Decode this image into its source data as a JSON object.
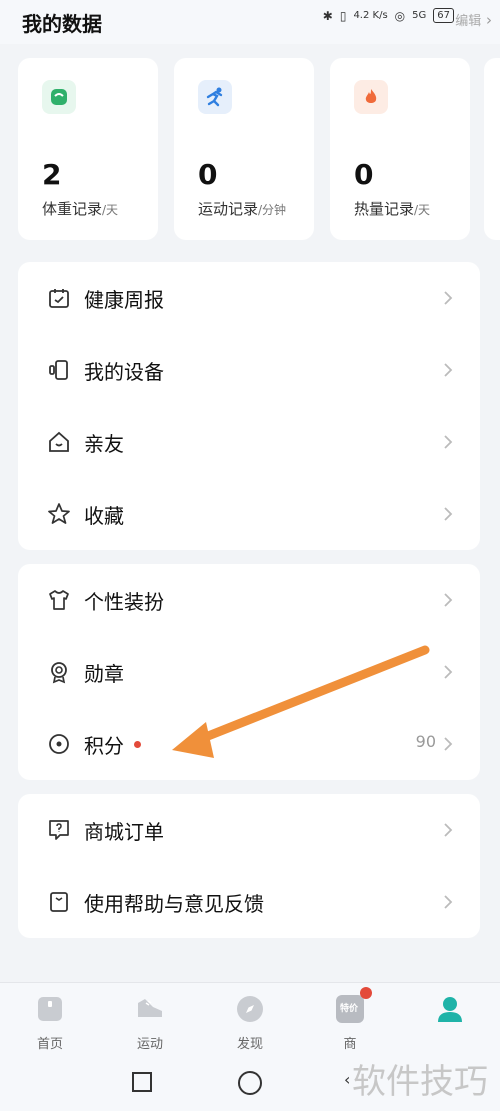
{
  "header": {
    "title": "我的数据",
    "status": {
      "network": "4.2 K/s",
      "signal": "5G",
      "battery": "67"
    },
    "edit_label": "编辑"
  },
  "stats": [
    {
      "icon": "scale-icon",
      "value": "2",
      "label": "体重记录",
      "unit": "/天",
      "color": "#2fb06b"
    },
    {
      "icon": "running-icon",
      "value": "0",
      "label": "运动记录",
      "unit": "/分钟",
      "color": "#2f7fe0"
    },
    {
      "icon": "flame-icon",
      "value": "0",
      "label": "热量记录",
      "unit": "/天",
      "color": "#f06a3a"
    }
  ],
  "menu_groups": [
    {
      "items": [
        {
          "icon": "calendar-icon",
          "label": "健康周报"
        },
        {
          "icon": "device-icon",
          "label": "我的设备"
        },
        {
          "icon": "home-icon",
          "label": "亲友"
        },
        {
          "icon": "star-icon",
          "label": "收藏"
        }
      ]
    },
    {
      "items": [
        {
          "icon": "shirt-icon",
          "label": "个性装扮"
        },
        {
          "icon": "medal-icon",
          "label": "勋章"
        },
        {
          "icon": "points-icon",
          "label": "积分",
          "value": "90",
          "dot": true
        }
      ]
    },
    {
      "items": [
        {
          "icon": "order-icon",
          "label": "商城订单"
        },
        {
          "icon": "help-icon",
          "label": "使用帮助与意见反馈"
        }
      ]
    }
  ],
  "bottom_nav": [
    {
      "icon": "home-tab-icon",
      "label": "首页"
    },
    {
      "icon": "shoe-tab-icon",
      "label": "运动"
    },
    {
      "icon": "compass-tab-icon",
      "label": "发现"
    },
    {
      "icon": "shop-tab-icon",
      "label": "商",
      "badge_text": "特价"
    },
    {
      "icon": "profile-tab-icon",
      "label": ""
    }
  ],
  "watermark": "软件技巧",
  "colors": {
    "accent": "#1fb3a8",
    "arrow": "#f0903a",
    "dot": "#e34a3a"
  }
}
